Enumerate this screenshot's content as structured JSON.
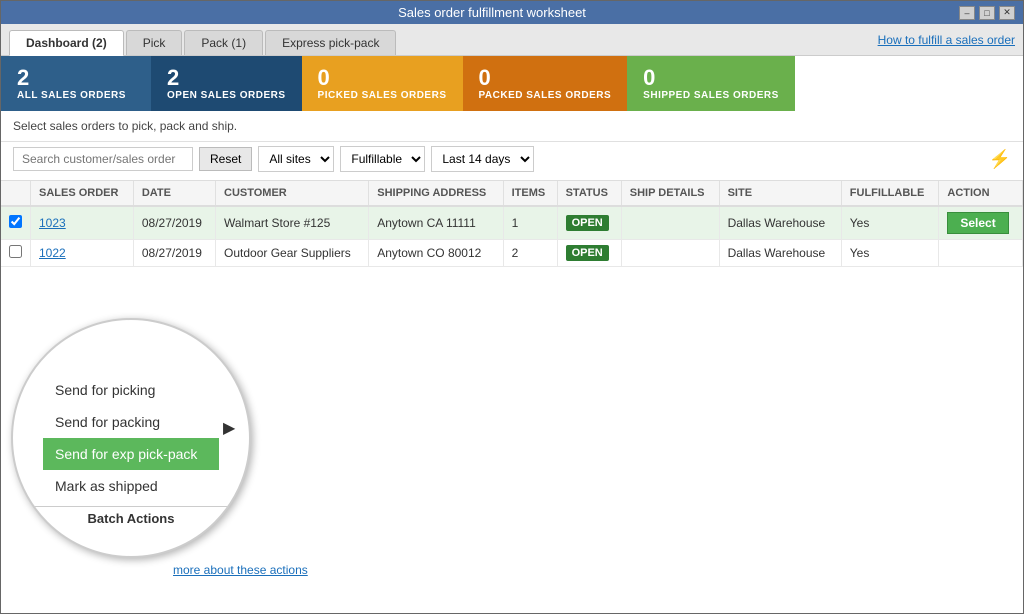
{
  "window": {
    "title": "Sales order fulfillment worksheet"
  },
  "tabs": [
    {
      "id": "dashboard",
      "label": "Dashboard",
      "badge": "2",
      "active": true
    },
    {
      "id": "pick",
      "label": "Pick",
      "badge": null,
      "active": false
    },
    {
      "id": "pack",
      "label": "Pack",
      "badge": "1",
      "active": false
    },
    {
      "id": "express",
      "label": "Express pick-pack",
      "badge": null,
      "active": false
    }
  ],
  "help_link": "How to fulfill a sales order",
  "stats": [
    {
      "id": "all-sales",
      "num": "2",
      "label": "ALL SALES ORDERS",
      "color": "stat-blue"
    },
    {
      "id": "open-sales",
      "num": "2",
      "label": "OPEN SALES ORDERS",
      "color": "stat-darkblue"
    },
    {
      "id": "picked",
      "num": "0",
      "label": "PICKED SALES ORDERS",
      "color": "stat-orange"
    },
    {
      "id": "packed",
      "num": "0",
      "label": "PACKED SALES ORDERS",
      "color": "stat-darkorange"
    },
    {
      "id": "shipped",
      "num": "0",
      "label": "SHIPPED SALES ORDERS",
      "color": "stat-green"
    }
  ],
  "toolbar": {
    "description": "Select sales orders to pick, pack and ship.",
    "search_placeholder": "Search customer/sales order",
    "reset_label": "Reset",
    "sites_options": [
      "All sites"
    ],
    "sites_selected": "All sites",
    "fulfillable_options": [
      "Fulfillable"
    ],
    "fulfillable_selected": "Fulfillable",
    "days_options": [
      "Last 14 days"
    ],
    "days_selected": "Last 14 days"
  },
  "table": {
    "columns": [
      "",
      "SALES ORDER",
      "DATE",
      "CUSTOMER",
      "SHIPPING ADDRESS",
      "ITEMS",
      "STATUS",
      "SHIP DETAILS",
      "SITE",
      "FULFILLABLE",
      "ACTION"
    ],
    "rows": [
      {
        "id": "row1",
        "checked": true,
        "selected": true,
        "order_num": "1023",
        "date": "08/27/2019",
        "customer": "Walmart Store #125",
        "shipping_address": "Anytown CA 11111",
        "items": "1",
        "status": "OPEN",
        "ship_details": "",
        "site": "Dallas Warehouse",
        "fulfillable": "Yes",
        "action": "Select"
      },
      {
        "id": "row2",
        "checked": false,
        "selected": false,
        "order_num": "1022",
        "date": "08/27/2019",
        "customer": "Outdoor Gear Suppliers",
        "shipping_address": "Anytown CO 80012",
        "items": "2",
        "status": "OPEN",
        "ship_details": "",
        "site": "Dallas Warehouse",
        "fulfillable": "Yes",
        "action": ""
      }
    ]
  },
  "circle_menu": {
    "items": [
      {
        "id": "send-picking",
        "label": "Send for picking",
        "highlighted": false
      },
      {
        "id": "send-packing",
        "label": "Send for packing",
        "highlighted": false
      },
      {
        "id": "send-exp-pick-pack",
        "label": "Send for exp pick-pack",
        "highlighted": true
      },
      {
        "id": "mark-shipped",
        "label": "Mark as shipped",
        "highlighted": false
      }
    ],
    "more_link": "more about these actions",
    "footer_label": "Batch Actions"
  }
}
